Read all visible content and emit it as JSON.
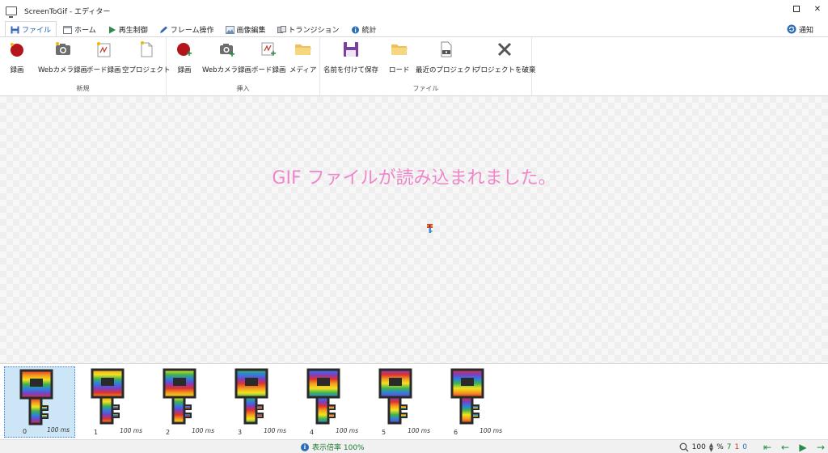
{
  "window": {
    "title": "ScreenToGif - エディター"
  },
  "tabs": [
    {
      "label": "ファイル",
      "active": true
    },
    {
      "label": "ホーム"
    },
    {
      "label": "再生制御"
    },
    {
      "label": "フレーム操作"
    },
    {
      "label": "画像編集"
    },
    {
      "label": "トランジション"
    },
    {
      "label": "統計"
    }
  ],
  "toolbar_right": {
    "notify_label": "通知"
  },
  "ribbon": {
    "groups": [
      {
        "label": "新規",
        "buttons": [
          "録画",
          "Webカメラ録画",
          "ボード録画",
          "空プロジェクト"
        ]
      },
      {
        "label": "挿入",
        "buttons": [
          "録画",
          "Webカメラ録画",
          "ボード録画",
          "メディア"
        ]
      },
      {
        "label": "ファイル",
        "buttons": [
          "名前を付けて保存",
          "ロード",
          "最近のプロジェクト",
          "プロジェクトを破棄"
        ]
      }
    ]
  },
  "canvas": {
    "message": "GIF ファイルが読み込まれました。"
  },
  "frames": [
    {
      "index": "0",
      "duration": "100 ms",
      "selected": true
    },
    {
      "index": "1",
      "duration": "100 ms"
    },
    {
      "index": "2",
      "duration": "100 ms"
    },
    {
      "index": "3",
      "duration": "100 ms"
    },
    {
      "index": "4",
      "duration": "100 ms"
    },
    {
      "index": "5",
      "duration": "100 ms"
    },
    {
      "index": "6",
      "duration": "100 ms"
    }
  ],
  "statusbar": {
    "zoom_text": "表示倍率 100%",
    "zoom_value": "100",
    "zoom_unit": "%",
    "frame_count": "7",
    "selected_count": "1",
    "selected_index": "0"
  },
  "colors": {
    "accent": "#1b5ea9",
    "message": "#ee86c9",
    "status_green": "#1d7a32",
    "status_red": "#c0392b",
    "status_blue": "#2c6fb7"
  }
}
